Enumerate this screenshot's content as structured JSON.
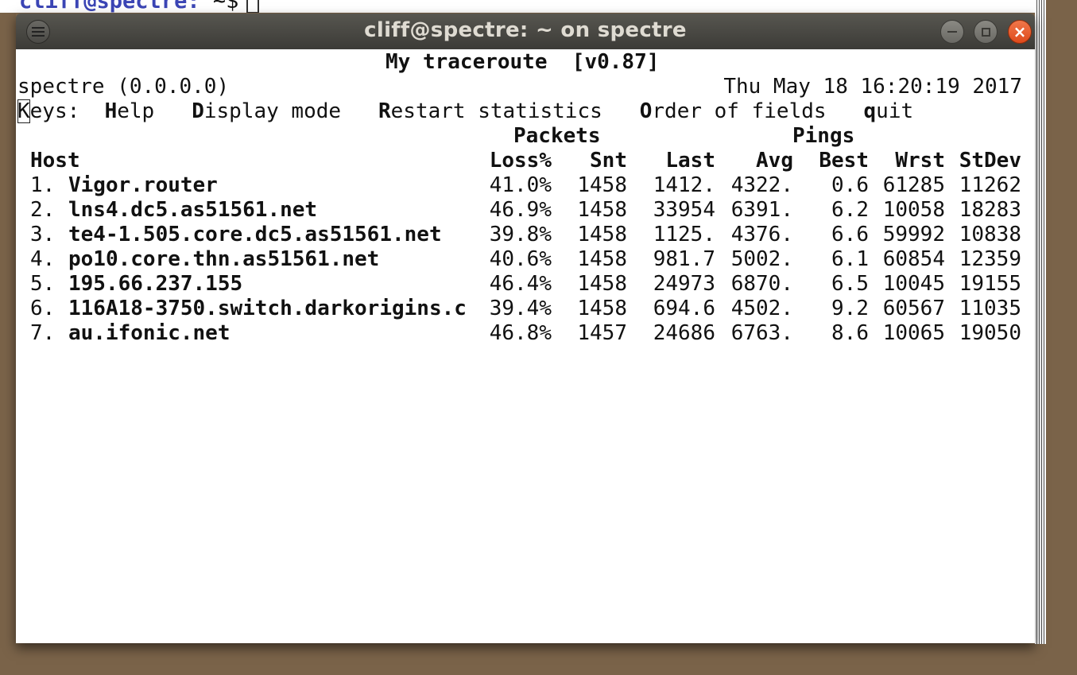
{
  "background_terminal": {
    "prompt_user": "cliff@spectre:",
    "prompt_path": " ~$"
  },
  "window": {
    "title": "cliff@spectre: ~ on spectre",
    "buttons": {
      "menu": "menu-icon",
      "minimize": "minimize-icon",
      "maximize": "maximize-icon",
      "close": "close-icon"
    }
  },
  "mtr": {
    "heading": "My traceroute  [v0.87]",
    "host_info": "spectre (0.0.0.0)",
    "timestamp": "Thu May 18 16:20:19 2017",
    "keys": {
      "label_key": "K",
      "label_rest": "eys:",
      "help_key": "H",
      "help_rest": "elp",
      "display_key": "D",
      "display_rest": "isplay mode",
      "restart_key": "R",
      "restart_rest": "estart statistics",
      "order_key": "O",
      "order_rest": "rder of fields",
      "quit_key": "q",
      "quit_rest": "uit"
    },
    "group_headers": {
      "packets": "Packets",
      "pings": "Pings"
    },
    "columns": {
      "host": "Host",
      "loss": "Loss%",
      "snt": "Snt",
      "last": "Last",
      "avg": "Avg",
      "best": "Best",
      "wrst": "Wrst",
      "stdev": "StDev"
    },
    "rows": [
      {
        "num": "1.",
        "host": "Vigor.router",
        "loss": "41.0%",
        "snt": "1458",
        "last": "1412.",
        "avg": "4322.",
        "best": "0.6",
        "wrst": "61285",
        "stdev": "11262"
      },
      {
        "num": "2.",
        "host": "lns4.dc5.as51561.net",
        "loss": "46.9%",
        "snt": "1458",
        "last": "33954",
        "avg": "6391.",
        "best": "6.2",
        "wrst": "10058",
        "stdev": "18283"
      },
      {
        "num": "3.",
        "host": "te4-1.505.core.dc5.as51561.net",
        "loss": "39.8%",
        "snt": "1458",
        "last": "1125.",
        "avg": "4376.",
        "best": "6.6",
        "wrst": "59992",
        "stdev": "10838"
      },
      {
        "num": "4.",
        "host": "po10.core.thn.as51561.net",
        "loss": "40.6%",
        "snt": "1458",
        "last": "981.7",
        "avg": "5002.",
        "best": "6.1",
        "wrst": "60854",
        "stdev": "12359"
      },
      {
        "num": "5.",
        "host": "195.66.237.155",
        "loss": "46.4%",
        "snt": "1458",
        "last": "24973",
        "avg": "6870.",
        "best": "6.5",
        "wrst": "10045",
        "stdev": "19155"
      },
      {
        "num": "6.",
        "host": "116A18-3750.switch.darkorigins.c",
        "loss": "39.4%",
        "snt": "1458",
        "last": "694.6",
        "avg": "4502.",
        "best": "9.2",
        "wrst": "60567",
        "stdev": "11035"
      },
      {
        "num": "7.",
        "host": "au.ifonic.net",
        "loss": "46.8%",
        "snt": "1457",
        "last": "24686",
        "avg": "6763.",
        "best": "8.6",
        "wrst": "10065",
        "stdev": "19050"
      }
    ]
  }
}
